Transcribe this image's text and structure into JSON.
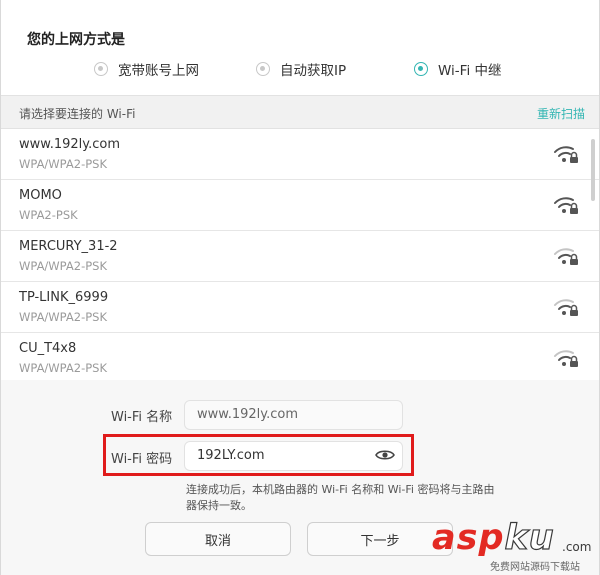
{
  "title": "您的上网方式是",
  "modes": [
    {
      "label": "宽带账号上网",
      "selected": false
    },
    {
      "label": "自动获取IP",
      "selected": false
    },
    {
      "label": "Wi-Fi 中继",
      "selected": true
    }
  ],
  "list_header": {
    "label": "请选择要连接的 Wi-Fi",
    "rescan": "重新扫描"
  },
  "networks": [
    {
      "ssid": "www.192ly.com",
      "security": "WPA/WPA2-PSK",
      "icon": "wifi-locked-icon"
    },
    {
      "ssid": "MOMO",
      "security": "WPA2-PSK",
      "icon": "wifi-locked-icon"
    },
    {
      "ssid": "MERCURY_31-2",
      "security": "WPA/WPA2-PSK",
      "icon": "wifi-locked-icon"
    },
    {
      "ssid": "TP-LINK_6999",
      "security": "WPA/WPA2-PSK",
      "icon": "wifi-locked-icon"
    },
    {
      "ssid": "CU_T4x8",
      "security": "WPA/WPA2-PSK",
      "icon": "wifi-locked-icon"
    }
  ],
  "form": {
    "name_label": "Wi-Fi 名称",
    "name_value": "www.192ly.com",
    "pwd_label": "Wi-Fi 密码",
    "pwd_value": "192LY.com",
    "note": "连接成功后，本机路由器的 Wi-Fi 名称和 Wi-Fi 密码将与主路由器保持一致。"
  },
  "buttons": {
    "cancel": "取消",
    "next": "下一步"
  },
  "watermark": {
    "brand_a": "asp",
    "brand_b": "ku",
    "brand_c": ".com",
    "sub": "免费网站源码下载站"
  },
  "colors": {
    "accent": "#34b6b3",
    "highlight": "#e01b1b",
    "watermark": "#e32a23"
  }
}
